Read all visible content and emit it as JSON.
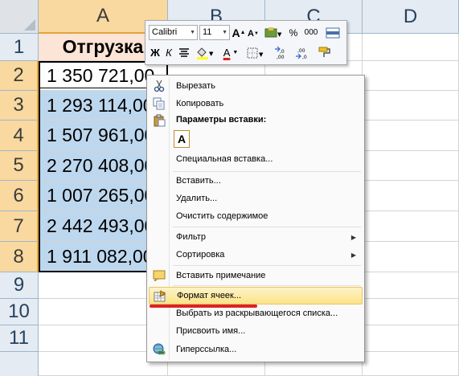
{
  "columns": [
    "A",
    "B",
    "C",
    "D"
  ],
  "rows": [
    "1",
    "2",
    "3",
    "4",
    "5",
    "6",
    "7",
    "8",
    "9",
    "10",
    "11"
  ],
  "cells": {
    "header": "Отгрузка",
    "values": [
      "1 350 721,00",
      "1 293 114,00",
      "1 507 961,00",
      "2 270 408,00",
      "1 007 265,00",
      "2 442 493,00",
      "1 911 082,00"
    ]
  },
  "mini_toolbar": {
    "font": "Calibri",
    "size": "11",
    "grow": "A",
    "shrink": "A",
    "percent": "%",
    "thousands": "000",
    "bold": "Ж",
    "italic": "К",
    "font_color_letter": "A",
    "inc_decimal": ",0 ,00",
    "dec_decimal": ",00 ,0"
  },
  "menu": {
    "cut": "Вырезать",
    "copy": "Копировать",
    "paste_header": "Параметры вставки:",
    "paste_option": "A",
    "special_paste": "Специальная вставка...",
    "insert": "Вставить...",
    "delete": "Удалить...",
    "clear": "Очистить содержимое",
    "filter": "Фильтр",
    "sort": "Сортировка",
    "insert_note": "Вставить примечание",
    "format_cells": "Формат ячеек...",
    "pick_list": "Выбрать из раскрывающегося списка...",
    "name": "Присвоить имя...",
    "hyperlink": "Гиперссылка..."
  },
  "colors": {
    "header_fill": "#fce4d6",
    "selection_fill": "#bdd7ee",
    "selected_heading": "#f9d99f",
    "menu_highlight": "#fbe38a",
    "underline_mark": "#dd2222"
  }
}
